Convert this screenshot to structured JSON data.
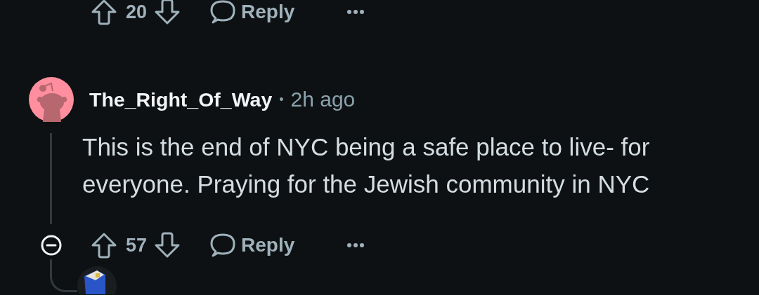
{
  "previous_comment_actions": {
    "score": "20",
    "reply_label": "Reply"
  },
  "comment": {
    "author": "The_Right_Of_Way",
    "separator": "•",
    "time": "2h ago",
    "body": "This is the end of NYC being a safe place to live- for everyone. Praying for the Jewish community in NYC",
    "expanded": true,
    "actions": {
      "score": "57",
      "reply_label": "Reply"
    }
  }
}
